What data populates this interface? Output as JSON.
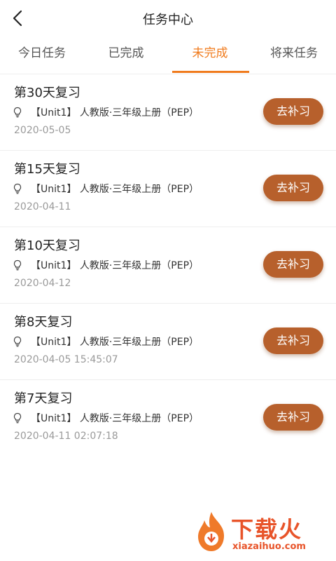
{
  "header": {
    "title": "任务中心"
  },
  "tabs": [
    {
      "label": "今日任务"
    },
    {
      "label": "已完成"
    },
    {
      "label": "未完成"
    },
    {
      "label": "将来任务"
    }
  ],
  "active_tab": "未完成",
  "tasks": [
    {
      "title": "第30天复习",
      "subtitle": "【Unit1】 人教版·三年级上册（PEP）",
      "date": "2020-05-05",
      "button": "去补习"
    },
    {
      "title": "第15天复习",
      "subtitle": "【Unit1】 人教版·三年级上册（PEP）",
      "date": "2020-04-11",
      "button": "去补习"
    },
    {
      "title": "第10天复习",
      "subtitle": "【Unit1】 人教版·三年级上册（PEP）",
      "date": "2020-04-12",
      "button": "去补习"
    },
    {
      "title": "第8天复习",
      "subtitle": "【Unit1】 人教版·三年级上册（PEP）",
      "date": "2020-04-05 15:45:07",
      "button": "去补习"
    },
    {
      "title": "第7天复习",
      "subtitle": "【Unit1】 人教版·三年级上册（PEP）",
      "date": "2020-04-11 02:07:18",
      "button": "去补习"
    }
  ],
  "watermark": {
    "name": "下载火",
    "url": "xiazaihuo.com"
  },
  "colors": {
    "accent": "#f07b1d",
    "button": "#b7602c",
    "date": "#9a9a9a",
    "watermark": "#e8542a"
  },
  "icons": {
    "back": "back-arrow-icon",
    "bulb": "lightbulb-icon"
  }
}
